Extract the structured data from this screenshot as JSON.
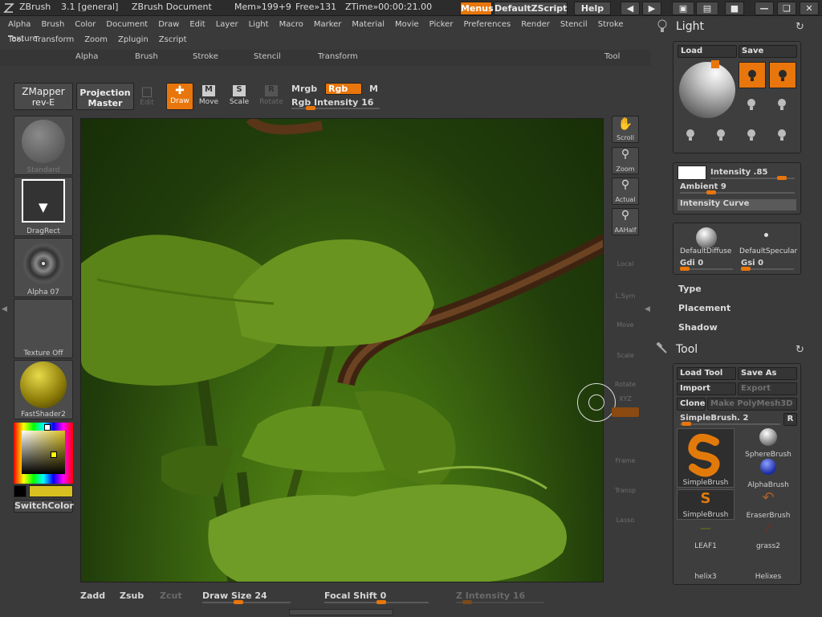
{
  "titlebar": {
    "app": "ZBrush",
    "version": "3.1 [general]",
    "doc": "ZBrush Document",
    "mem": "Mem»199+9",
    "free": "Free»131",
    "ztime": "ZTime»00:00:21.00",
    "menus_btn": "Menus",
    "script_btn": "DefaultZScript",
    "help_btn": "Help"
  },
  "menubar": {
    "row1": [
      "Alpha",
      "Brush",
      "Color",
      "Document",
      "Draw",
      "Edit",
      "Layer",
      "Light",
      "Macro",
      "Marker",
      "Material",
      "Movie",
      "Picker",
      "Preferences",
      "Render",
      "Stencil",
      "Stroke",
      "Texture"
    ],
    "row2": [
      "Tool",
      "Transform",
      "Zoom",
      "Zplugin",
      "Zscript"
    ]
  },
  "subpalette": {
    "alpha": "Alpha",
    "brush": "Brush",
    "stroke": "Stroke",
    "stencil": "Stencil",
    "transform": "Transform",
    "tool": "Tool"
  },
  "toolbar": {
    "zmapper_l1": "ZMapper",
    "zmapper_l2": "rev-E",
    "proj_l1": "Projection",
    "proj_l2": "Master",
    "edit": "Edit",
    "draw": "Draw",
    "move": "Move",
    "scale": "Scale",
    "rotate": "Rotate",
    "mrgb": "Mrgb",
    "rgb": "Rgb",
    "m": "M",
    "rgb_intensity": "Rgb Intensity 16"
  },
  "left": {
    "standard": "Standard",
    "dragrect": "DragRect",
    "alpha": "Alpha 07",
    "texture": "Texture Off",
    "material": "FastShader2",
    "switchcolor": "SwitchColor"
  },
  "rail": {
    "scroll": "Scroll",
    "zoom": "Zoom",
    "actual": "Actual",
    "aahalf": "AAHalf",
    "local": "Local",
    "lsym": "L.Sym",
    "move": "Move",
    "scale": "Scale",
    "rotate": "Rotate",
    "xyz": "XYZ",
    "frame": "Frame",
    "transp": "Transp",
    "lasso": "Lasso"
  },
  "light": {
    "title": "Light",
    "load": "Load",
    "save": "Save",
    "intensity": "Intensity .85",
    "ambient": "Ambient 9",
    "curve": "Intensity Curve",
    "diffuse": "DefaultDiffuse",
    "specular": "DefaultSpecular",
    "gdi": "Gdi 0",
    "gsi": "Gsi 0",
    "type": "Type",
    "placement": "Placement",
    "shadow": "Shadow",
    "intensity_value": 0.85,
    "ambient_value": 0.09
  },
  "tool": {
    "title": "Tool",
    "load": "Load Tool",
    "saveas": "Save As",
    "import": "Import",
    "export": "Export",
    "clone": "Clone",
    "makepoly": "Make PolyMesh3D",
    "simplebrush_label": "SimpleBrush. 2",
    "r": "R",
    "brushes": [
      "SimpleBrush",
      "SphereBrush",
      "AlphaBrush",
      "SimpleBrush",
      "EraserBrush",
      "LEAF1",
      "grass2",
      "helix3",
      "Helixes"
    ]
  },
  "bottom": {
    "zadd": "Zadd",
    "zsub": "Zsub",
    "zcut": "Zcut",
    "drawsize": "Draw Size 24",
    "focal": "Focal Shift 0",
    "zint": "Z Intensity 16"
  },
  "colors": {
    "accent": "#e8760c",
    "primary_color": "#d8c020",
    "bg": "#3a3a3a"
  }
}
